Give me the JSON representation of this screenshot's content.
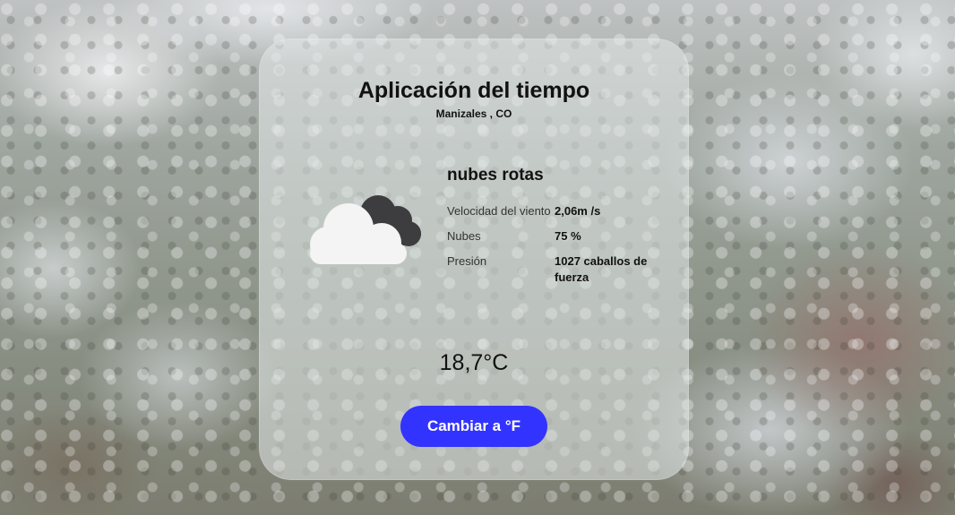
{
  "app": {
    "title": "Aplicación del tiempo",
    "location": "Manizales , CO"
  },
  "weather": {
    "description": "nubes rotas",
    "icon": "broken-clouds-icon",
    "details": [
      {
        "label": "Velocidad del viento",
        "value": "2,06m /s"
      },
      {
        "label": "Nubes",
        "value": "75 %"
      },
      {
        "label": "Presión",
        "value": "1027 caballos de fuerza"
      }
    ],
    "temperature": "18,7°C"
  },
  "controls": {
    "toggle_unit_label": "Cambiar a °F"
  },
  "colors": {
    "button": "#3333ff",
    "cloud_front": "#f3f3f3",
    "cloud_back": "#3d3d3f"
  }
}
